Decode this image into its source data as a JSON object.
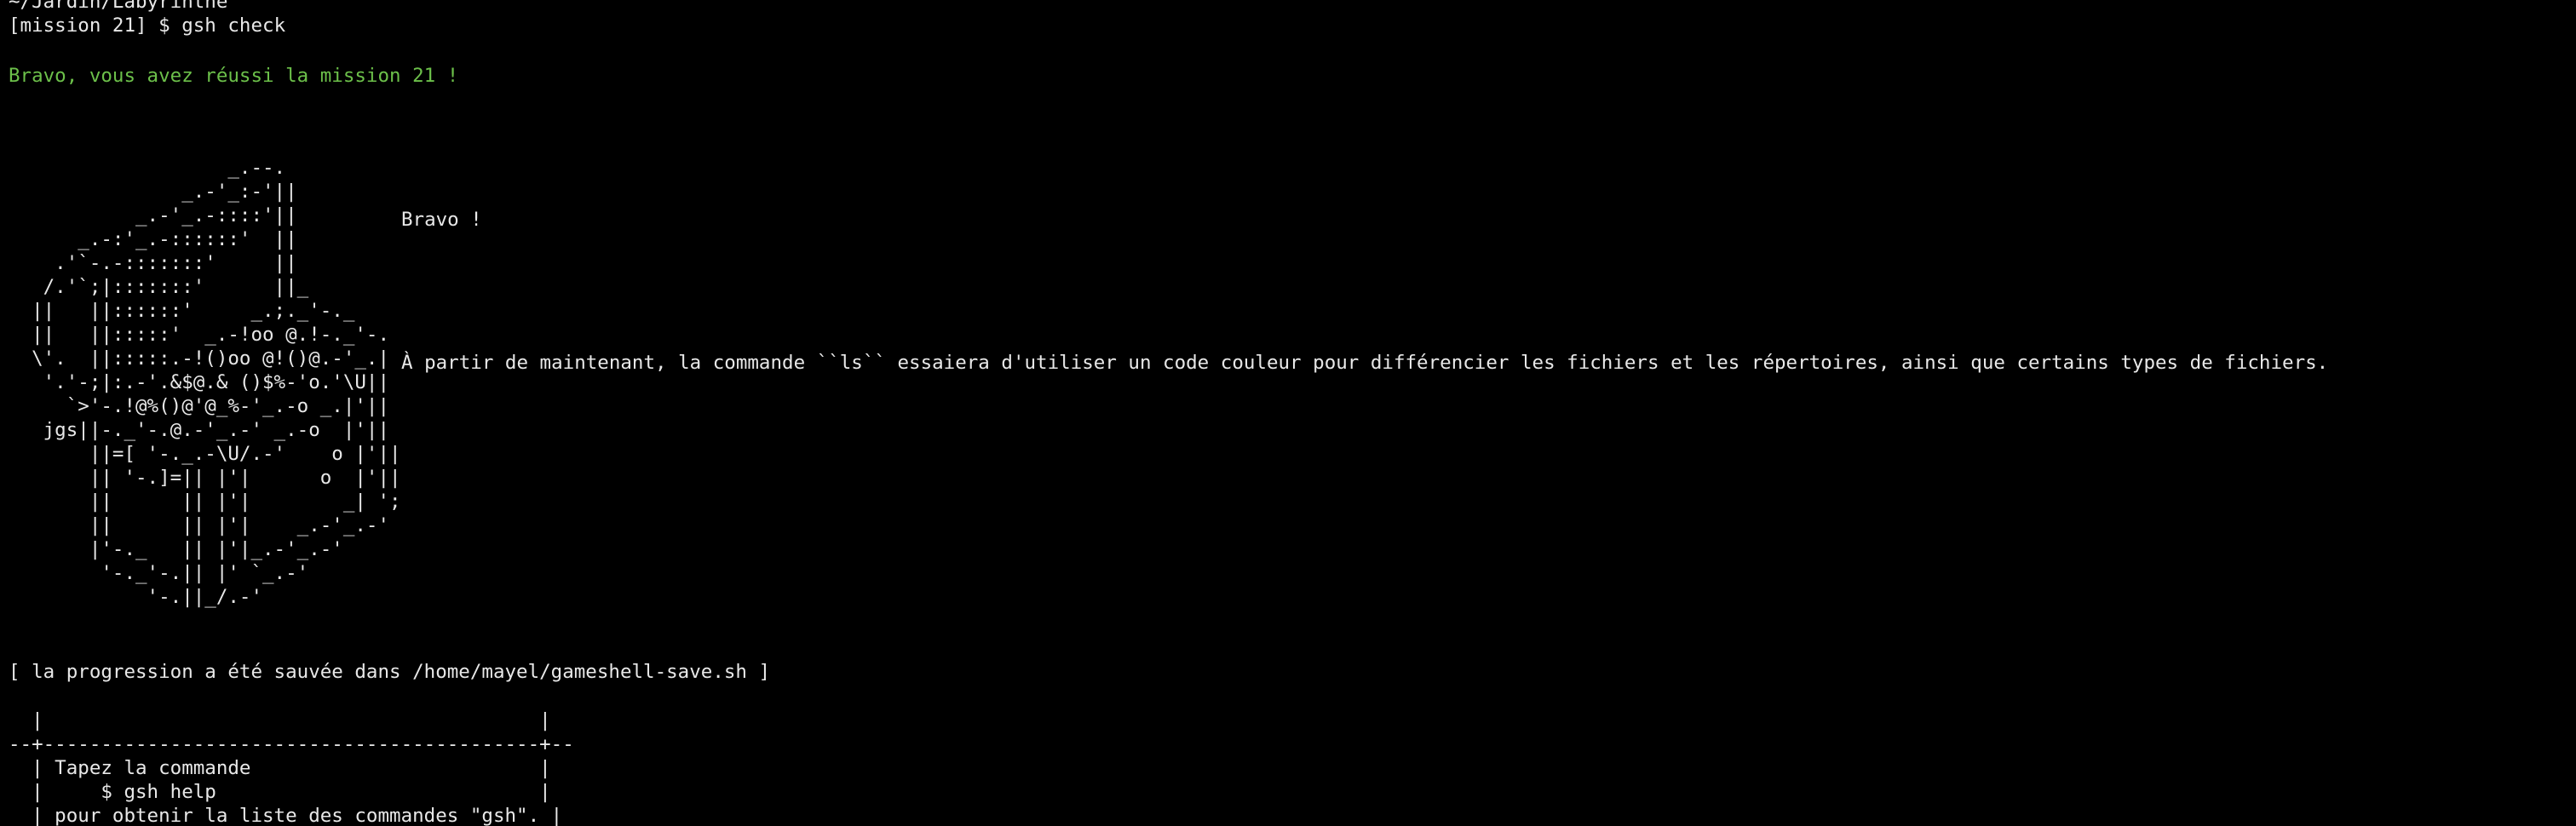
{
  "terminal": {
    "cwd_line": "~/Jardin/Labyrinthe",
    "prompt": "[mission 21] $ ",
    "command": "gsh check",
    "success_message": "Bravo, vous avez réussi la mission 21 !",
    "ascii_art": "                   _.--.\n               _.-'_:-'||\n           _.-'_.-::::'||\n      _.-:'_.-::::::'  ||\n    .'`-.-:::::::'     ||\n   /.'`;|:::::::'      ||_\n  ||   ||::::::'     _.;._'-._\n  ||   ||:::::'  _.-!oo @.!-._'-.\n  \\'.  ||:::::.-!()oo @!()@.-'_.|\n   '.'-;|:.-'.&$@.& ()$%-'o.'\\U||\n     `>'-.!@%()@'@_%-'_.-o _.|'||\n   jgs||-._'-.@.-'_.-' _.-o  |'||\n       ||=[ '-._.-\\U/.-'    o |'||\n       || '-.]=|| |'|      o  |'||\n       ||      || |'|        _| ';\n       ||      || |'|    _.-'_.-'\n       |'-._   || |'|_.-'_.-'\n        '-._'-.|| |' `_.-'\n            '-.||_/.-'",
    "bravo_title": "Bravo !",
    "bravo_body": "À partir de maintenant, la commande ``ls`` essaiera d'utiliser un code couleur pour différencier les fichiers et les répertoires, ainsi que certains types de fichiers.",
    "save_notice": "[ la progression a été sauvée dans /home/mayel/gameshell-save.sh ]",
    "help_box": "  |                                           |\n--+-------------------------------------------+--\n  | Tapez la commande                         |\n  |     $ gsh help                            |\n  | pour obtenir la liste des commandes \"gsh\". |"
  },
  "colors": {
    "background": "#000000",
    "text": "#e8e8e8",
    "success": "#6cc04a"
  }
}
